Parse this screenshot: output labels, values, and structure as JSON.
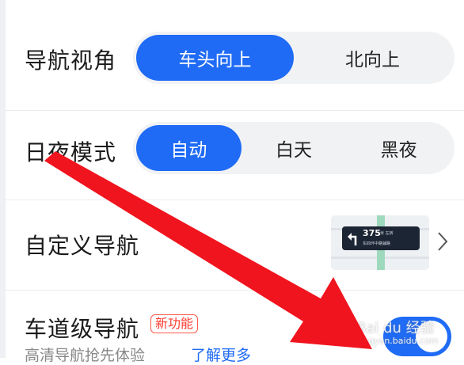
{
  "settings": {
    "nav_view": {
      "label": "导航视角",
      "options": [
        "车头向上",
        "北向上"
      ],
      "selected": "车头向上"
    },
    "day_night": {
      "label": "日夜模式",
      "options": [
        "自动",
        "白天",
        "黑夜"
      ],
      "selected": "自动"
    },
    "custom_nav": {
      "label": "自定义导航",
      "preview": {
        "distance": "375",
        "unit": "米 左转",
        "street": "东四环中路辅路"
      },
      "chevron_icon": "chevron-right-icon"
    },
    "lane_nav": {
      "label": "车道级导航",
      "badge": "新功能",
      "description": "高清导航抢先体验",
      "learn_more": "了解更多",
      "toggle_on": true
    }
  },
  "watermark": {
    "text": "Bai du 经验",
    "url": "jingyan.baidu.com"
  },
  "colors": {
    "accent": "#1f6bf5",
    "badge_red": "#ff3b2f",
    "annotation_arrow": "#f0141e"
  }
}
